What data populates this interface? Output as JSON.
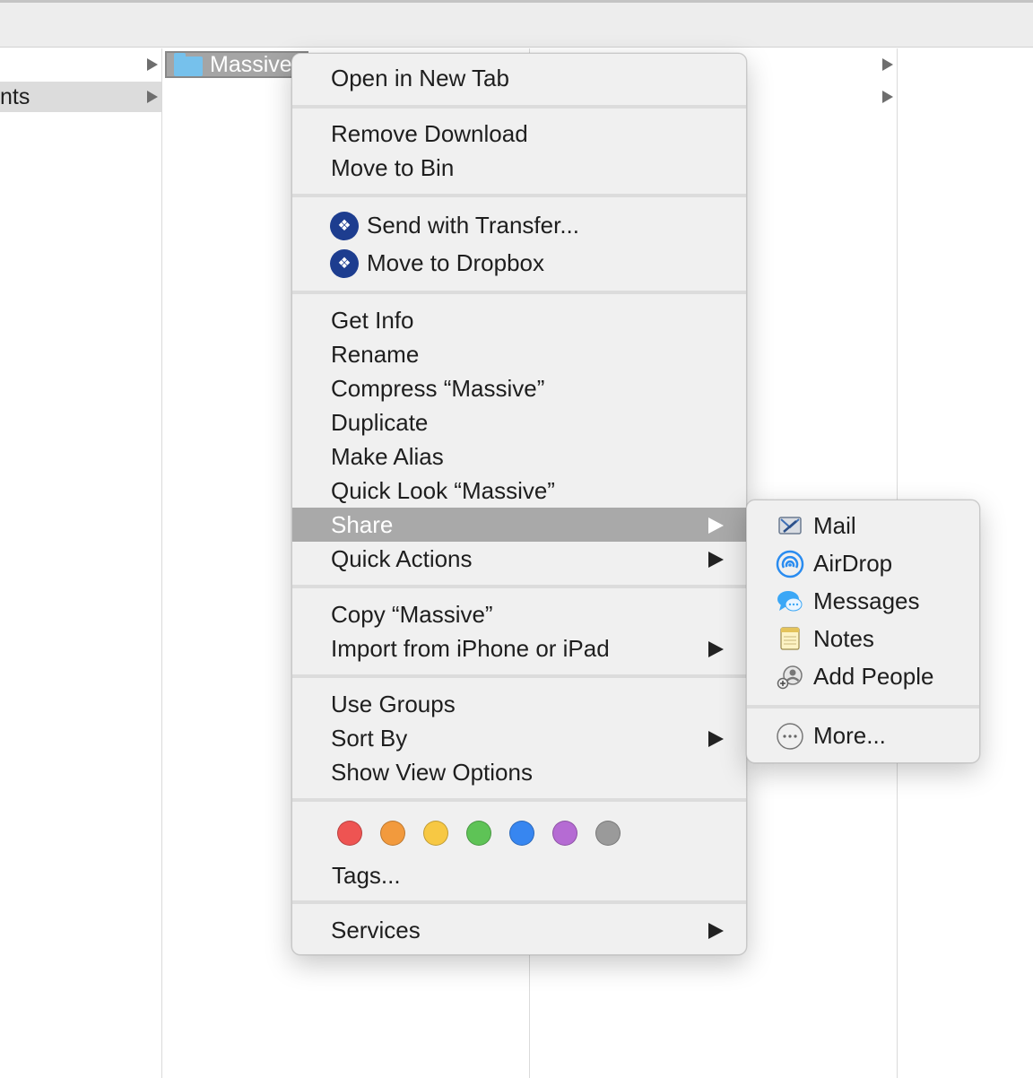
{
  "sidebar": {
    "partial_item_label": "nts"
  },
  "finder": {
    "selected_folder": "Massive"
  },
  "context_menu": {
    "open_new_tab": "Open in New Tab",
    "remove_download": "Remove Download",
    "move_to_bin": "Move to Bin",
    "send_with_transfer": "Send with Transfer...",
    "move_to_dropbox": "Move to Dropbox",
    "get_info": "Get Info",
    "rename": "Rename",
    "compress": "Compress “Massive”",
    "duplicate": "Duplicate",
    "make_alias": "Make Alias",
    "quick_look": "Quick Look “Massive”",
    "share": "Share",
    "quick_actions": "Quick Actions",
    "copy": "Copy “Massive”",
    "import_iphone": "Import from iPhone or iPad",
    "use_groups": "Use Groups",
    "sort_by": "Sort By",
    "show_view_options": "Show View Options",
    "tags": "Tags...",
    "services": "Services",
    "tag_colors": [
      "#ee5452",
      "#f29a3d",
      "#f7c843",
      "#5ec356",
      "#3786f0",
      "#b56bd3",
      "#9a9a9a"
    ]
  },
  "share_menu": {
    "mail": "Mail",
    "airdrop": "AirDrop",
    "messages": "Messages",
    "notes": "Notes",
    "add_people": "Add People",
    "more": "More..."
  },
  "colors": {
    "highlight": "#a9a9a9",
    "menu_bg": "#f0f0f0",
    "dropbox": "#1d3d8f"
  }
}
